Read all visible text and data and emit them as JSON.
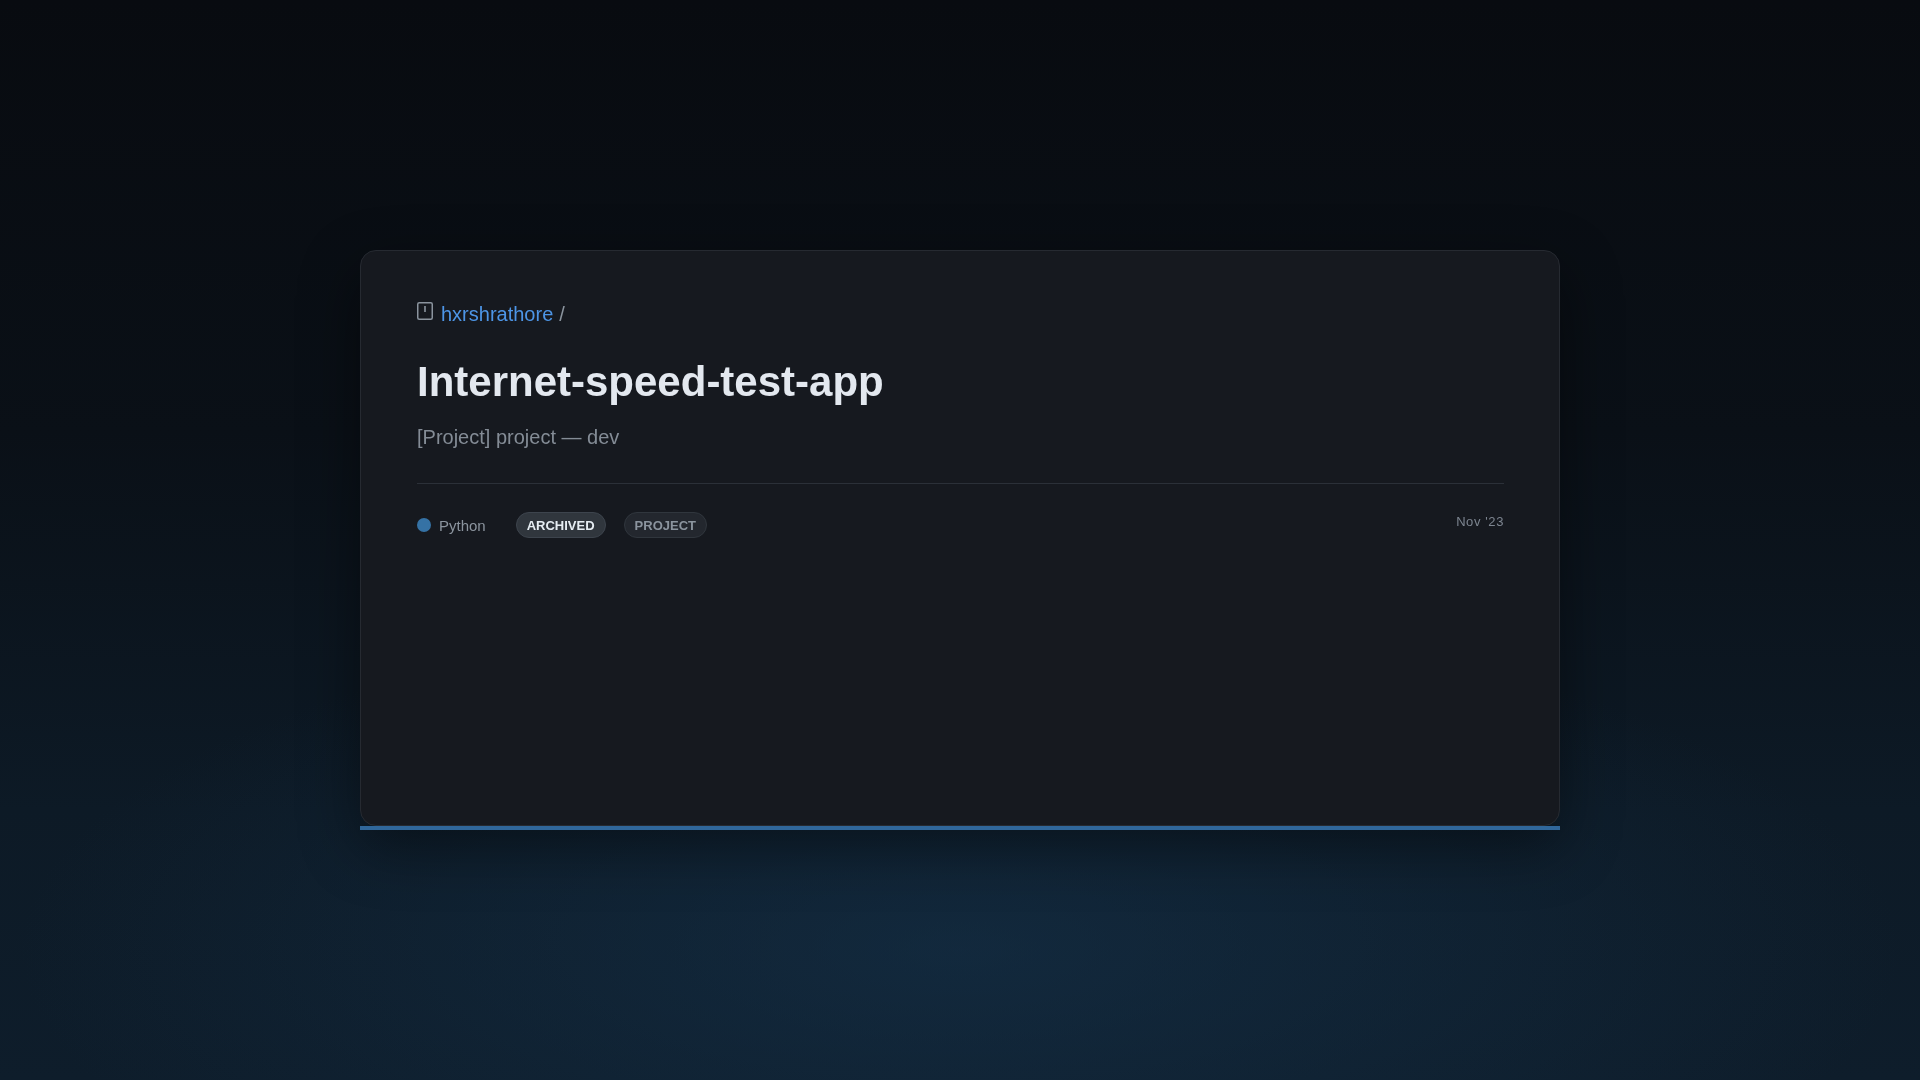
{
  "card": {
    "owner": "hxrshrathore",
    "separator": "/",
    "title": "Internet-speed-test-app",
    "description": "[Project] project — dev",
    "language": "Python",
    "tags": [
      {
        "label": "ARCHIVED",
        "kind": "status"
      },
      {
        "label": "PROJECT",
        "kind": "type"
      }
    ],
    "date": "Nov '23"
  }
}
